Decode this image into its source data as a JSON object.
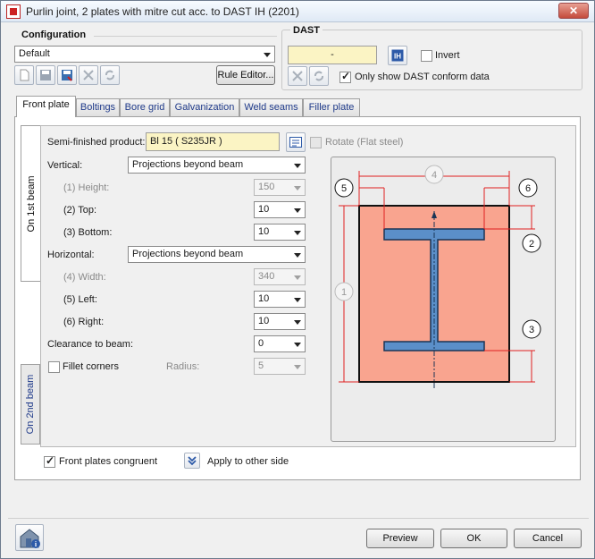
{
  "window": {
    "title": "Purlin joint, 2 plates with mitre cut acc. to DAST IH (2201)",
    "close_label": "✕"
  },
  "configuration": {
    "header": "Configuration",
    "selected": "Default",
    "rule_editor_label": "Rule Editor..."
  },
  "dast": {
    "header": "DAST",
    "value": "-",
    "invert_label": "Invert",
    "invert_checked": false,
    "only_show_label": "Only show DAST conform data",
    "only_show_checked": true
  },
  "tabs": [
    {
      "label": "Front plate",
      "active": true
    },
    {
      "label": "Boltings"
    },
    {
      "label": "Bore grid"
    },
    {
      "label": "Galvanization"
    },
    {
      "label": "Weld seams"
    },
    {
      "label": "Filler plate"
    }
  ],
  "side_tabs": [
    {
      "label": "On 1st beam",
      "active": true
    },
    {
      "label": "On 2nd beam"
    }
  ],
  "form": {
    "semi_finished_label": "Semi-finished product:",
    "semi_finished_value": "Bl 15  ( S235JR )",
    "rotate_label": "Rotate (Flat steel)",
    "vertical_label": "Vertical:",
    "vertical_value": "Projections beyond beam",
    "height_label": "(1) Height:",
    "height_value": "150",
    "top_label": "(2) Top:",
    "top_value": "10",
    "bottom_label": "(3) Bottom:",
    "bottom_value": "10",
    "horizontal_label": "Horizontal:",
    "horizontal_value": "Projections beyond beam",
    "width_label": "(4) Width:",
    "width_value": "340",
    "left_label": "(5) Left:",
    "left_value": "10",
    "right_label": "(6) Right:",
    "right_value": "10",
    "clearance_label": "Clearance to beam:",
    "clearance_value": "0",
    "fillet_label": "Fillet corners",
    "radius_label": "Radius:",
    "radius_value": "5"
  },
  "diagram": {
    "labels": [
      "1",
      "2",
      "3",
      "4",
      "5",
      "6"
    ]
  },
  "bottom": {
    "congruent_label": "Front plates congruent",
    "apply_label": "Apply to other side",
    "preview_label": "Preview",
    "ok_label": "OK",
    "cancel_label": "Cancel"
  },
  "colors": {
    "plate": "#f9a48f",
    "beam": "#5b8fc9",
    "dimension": "#e02020",
    "accent": "#1f3a8a"
  }
}
